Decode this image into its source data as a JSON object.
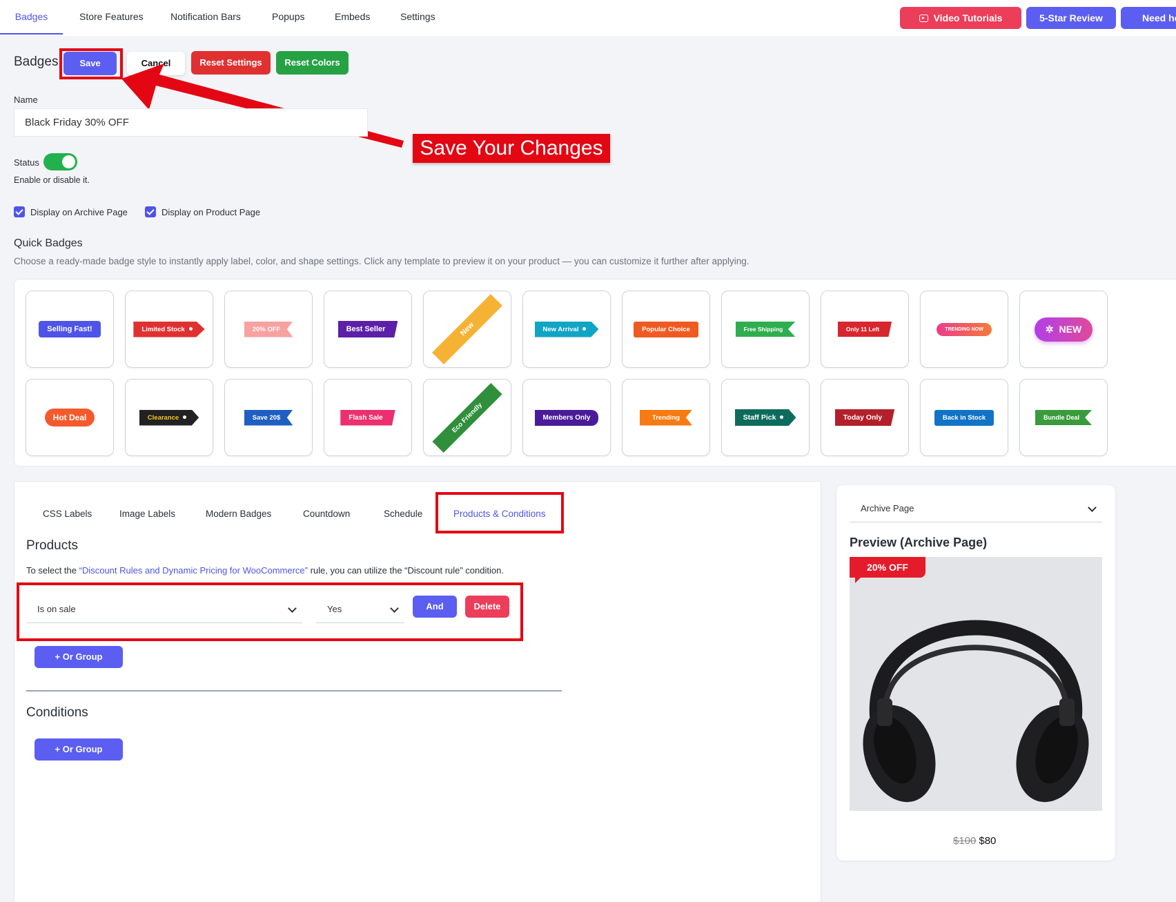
{
  "nav": {
    "tabs": [
      {
        "label": "Badges",
        "active": true
      },
      {
        "label": "Store Features"
      },
      {
        "label": "Notification Bars"
      },
      {
        "label": "Popups"
      },
      {
        "label": "Embeds"
      },
      {
        "label": "Settings"
      }
    ],
    "video_tutorials": "Video Tutorials",
    "five_star_review": "5-Star Review",
    "need_help": "Need he"
  },
  "header": {
    "title": "Badges",
    "save": "Save",
    "cancel": "Cancel",
    "reset_settings": "Reset Settings",
    "reset_colors": "Reset Colors"
  },
  "form": {
    "name_label": "Name",
    "name_value": "Black Friday 30% OFF",
    "status_label": "Status",
    "status_on": true,
    "status_help": "Enable or disable it.",
    "display_archive": "Display on Archive Page",
    "display_product": "Display on Product Page"
  },
  "annotation": "Save Your Changes",
  "quick_badges": {
    "title": "Quick Badges",
    "description": "Choose a ready-made badge style to instantly apply label, color, and shape settings. Click any template to preview it on your product — you can customize it further after applying.",
    "row1": [
      {
        "label": "Selling Fast!",
        "color": "#4f54e8"
      },
      {
        "label": "Limited Stock",
        "color": "#e03131"
      },
      {
        "label": "20% OFF",
        "color": "#f7a1a1"
      },
      {
        "label": "Best Seller",
        "color": "#5b1fa8"
      },
      {
        "label": "New",
        "color": "#f5b234"
      },
      {
        "label": "New Arrival",
        "color": "#10a5c4"
      },
      {
        "label": "Popular Choice",
        "color": "#f05a22"
      },
      {
        "label": "Free Shipping",
        "color": "#2fae4f"
      },
      {
        "label": "Only 11 Left",
        "color": "#d8262e"
      },
      {
        "label": "TRENDING NOW",
        "color": "#ef4f7d"
      },
      {
        "label": "NEW",
        "color": "#c13ee0"
      }
    ],
    "row2": [
      {
        "label": "Hot Deal",
        "color": "#f55a2c"
      },
      {
        "label": "Clearance",
        "color": "#222222"
      },
      {
        "label": "Save 20$",
        "color": "#1e5fc1"
      },
      {
        "label": "Flash Sale",
        "color": "#ec2f6f"
      },
      {
        "label": "Eco Friendly",
        "color": "#2f8f3b"
      },
      {
        "label": "Members Only",
        "color": "#4a1b99"
      },
      {
        "label": "Trending",
        "color": "#f77a12"
      },
      {
        "label": "Staff Pick",
        "color": "#0e6b5b"
      },
      {
        "label": "Today Only",
        "color": "#b3202a"
      },
      {
        "label": "Back in Stock",
        "color": "#1273c6"
      },
      {
        "label": "Bundle Deal",
        "color": "#3a9b3c"
      }
    ]
  },
  "sub_tabs": [
    "CSS Labels",
    "Image Labels",
    "Modern Badges",
    "Countdown",
    "Schedule",
    "Products & Conditions"
  ],
  "products": {
    "title": "Products",
    "rule_prefix": "To select the ",
    "rule_link": "“Discount Rules and Dynamic Pricing for WooCommerce”",
    "rule_suffix": " rule, you can utilize the “Discount rule” condition.",
    "condition_select": "Is on sale",
    "value_select": "Yes",
    "and_btn": "And",
    "delete_btn": "Delete",
    "or_group": "+ Or Group"
  },
  "conditions": {
    "title": "Conditions",
    "or_group": "+ Or Group"
  },
  "preview": {
    "page_select": "Archive Page",
    "title": "Preview (Archive Page)",
    "badge": "20% OFF",
    "old_price": "$100",
    "new_price": "$80"
  },
  "colors": {
    "accent": "#4f54e8",
    "highlight": "#e30613",
    "success": "#22b14c",
    "danger": "#e03131"
  }
}
